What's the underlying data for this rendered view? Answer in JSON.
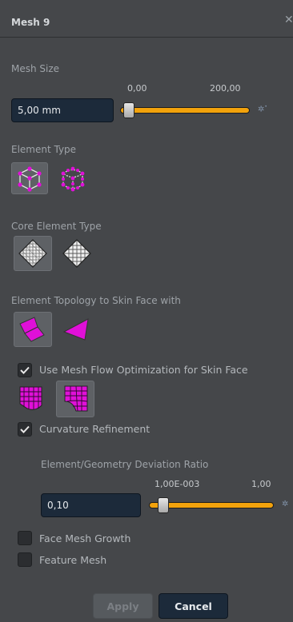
{
  "panel": {
    "title": "Mesh 9",
    "close_icon": "close-icon"
  },
  "mesh_size": {
    "label": "Mesh Size",
    "min_label": "0,00",
    "max_label": "200,00",
    "value": "5,00 mm",
    "slider_fraction": 0.025
  },
  "element_type": {
    "label": "Element Type",
    "options": [
      "hex-cube-icon",
      "hex-cube-rounded-icon"
    ],
    "selected_index": 0
  },
  "core_element_type": {
    "label": "Core Element Type",
    "options": [
      "diamond-mesh-fine-icon",
      "diamond-mesh-coarse-icon"
    ],
    "selected_index": 0
  },
  "topology": {
    "label": "Element Topology to Skin Face with",
    "options": [
      "quad-tri-icon",
      "triangle-icon"
    ],
    "selected_index": 0
  },
  "mesh_flow": {
    "label": "Use Mesh Flow Optimization for Skin Face",
    "checked": true,
    "options": [
      "flow-grid-icon",
      "flow-grid-curved-icon"
    ],
    "selected_index": 1
  },
  "curvature": {
    "label": "Curvature Refinement",
    "checked": true
  },
  "deviation": {
    "label": "Element/Geometry Deviation Ratio",
    "min_label": "1,00E-003",
    "max_label": "1,00",
    "value": "0,10",
    "slider_fraction": 0.08
  },
  "face_mesh_growth": {
    "label": "Face Mesh Growth",
    "checked": false
  },
  "feature_mesh": {
    "label": "Feature Mesh",
    "checked": false
  },
  "buttons": {
    "apply": "Apply",
    "cancel": "Cancel"
  },
  "colors": {
    "accent": "#f2a20c",
    "mesh_magenta": "#e010d8",
    "field_bg": "#1c2a3a"
  }
}
